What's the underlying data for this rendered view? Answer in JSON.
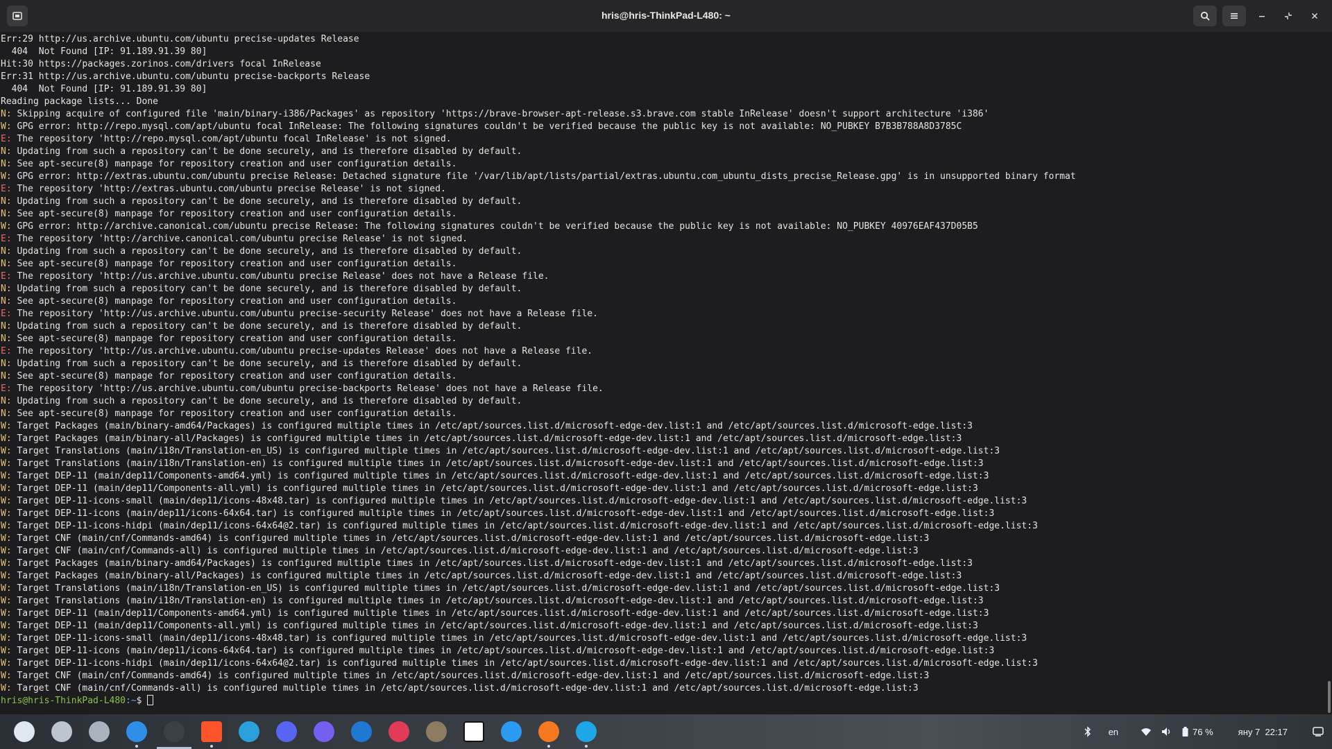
{
  "window": {
    "title": "hris@hris-ThinkPad-L480: ~",
    "icons": {
      "new_tab": "terminal-tab-icon",
      "search": "search-icon",
      "menu": "hamburger-menu-icon",
      "minimize": "minimize-icon",
      "restore": "restore-icon",
      "close": "close-icon"
    }
  },
  "terminal": {
    "lines": [
      {
        "p": "",
        "t": "Err:29 http://us.archive.ubuntu.com/ubuntu precise-updates Release"
      },
      {
        "p": "",
        "t": "  404  Not Found [IP: 91.189.91.39 80]"
      },
      {
        "p": "",
        "t": "Hit:30 https://packages.zorinos.com/drivers focal InRelease"
      },
      {
        "p": "",
        "t": "Err:31 http://us.archive.ubuntu.com/ubuntu precise-backports Release"
      },
      {
        "p": "",
        "t": "  404  Not Found [IP: 91.189.91.39 80]"
      },
      {
        "p": "",
        "t": "Reading package lists... Done"
      },
      {
        "p": "N:",
        "t": " Skipping acquire of configured file 'main/binary-i386/Packages' as repository 'https://brave-browser-apt-release.s3.brave.com stable InRelease' doesn't support architecture 'i386'"
      },
      {
        "p": "W:",
        "t": " GPG error: http://repo.mysql.com/apt/ubuntu focal InRelease: The following signatures couldn't be verified because the public key is not available: NO_PUBKEY B7B3B788A8D3785C"
      },
      {
        "p": "E:",
        "t": " The repository 'http://repo.mysql.com/apt/ubuntu focal InRelease' is not signed."
      },
      {
        "p": "N:",
        "t": " Updating from such a repository can't be done securely, and is therefore disabled by default."
      },
      {
        "p": "N:",
        "t": " See apt-secure(8) manpage for repository creation and user configuration details."
      },
      {
        "p": "W:",
        "t": " GPG error: http://extras.ubuntu.com/ubuntu precise Release: Detached signature file '/var/lib/apt/lists/partial/extras.ubuntu.com_ubuntu_dists_precise_Release.gpg' is in unsupported binary format"
      },
      {
        "p": "E:",
        "t": " The repository 'http://extras.ubuntu.com/ubuntu precise Release' is not signed."
      },
      {
        "p": "N:",
        "t": " Updating from such a repository can't be done securely, and is therefore disabled by default."
      },
      {
        "p": "N:",
        "t": " See apt-secure(8) manpage for repository creation and user configuration details."
      },
      {
        "p": "W:",
        "t": " GPG error: http://archive.canonical.com/ubuntu precise Release: The following signatures couldn't be verified because the public key is not available: NO_PUBKEY 40976EAF437D05B5"
      },
      {
        "p": "E:",
        "t": " The repository 'http://archive.canonical.com/ubuntu precise Release' is not signed."
      },
      {
        "p": "N:",
        "t": " Updating from such a repository can't be done securely, and is therefore disabled by default."
      },
      {
        "p": "N:",
        "t": " See apt-secure(8) manpage for repository creation and user configuration details."
      },
      {
        "p": "E:",
        "t": " The repository 'http://us.archive.ubuntu.com/ubuntu precise Release' does not have a Release file."
      },
      {
        "p": "N:",
        "t": " Updating from such a repository can't be done securely, and is therefore disabled by default."
      },
      {
        "p": "N:",
        "t": " See apt-secure(8) manpage for repository creation and user configuration details."
      },
      {
        "p": "E:",
        "t": " The repository 'http://us.archive.ubuntu.com/ubuntu precise-security Release' does not have a Release file."
      },
      {
        "p": "N:",
        "t": " Updating from such a repository can't be done securely, and is therefore disabled by default."
      },
      {
        "p": "N:",
        "t": " See apt-secure(8) manpage for repository creation and user configuration details."
      },
      {
        "p": "E:",
        "t": " The repository 'http://us.archive.ubuntu.com/ubuntu precise-updates Release' does not have a Release file."
      },
      {
        "p": "N:",
        "t": " Updating from such a repository can't be done securely, and is therefore disabled by default."
      },
      {
        "p": "N:",
        "t": " See apt-secure(8) manpage for repository creation and user configuration details."
      },
      {
        "p": "E:",
        "t": " The repository 'http://us.archive.ubuntu.com/ubuntu precise-backports Release' does not have a Release file."
      },
      {
        "p": "N:",
        "t": " Updating from such a repository can't be done securely, and is therefore disabled by default."
      },
      {
        "p": "N:",
        "t": " See apt-secure(8) manpage for repository creation and user configuration details."
      },
      {
        "p": "W:",
        "t": " Target Packages (main/binary-amd64/Packages) is configured multiple times in /etc/apt/sources.list.d/microsoft-edge-dev.list:1 and /etc/apt/sources.list.d/microsoft-edge.list:3"
      },
      {
        "p": "W:",
        "t": " Target Packages (main/binary-all/Packages) is configured multiple times in /etc/apt/sources.list.d/microsoft-edge-dev.list:1 and /etc/apt/sources.list.d/microsoft-edge.list:3"
      },
      {
        "p": "W:",
        "t": " Target Translations (main/i18n/Translation-en_US) is configured multiple times in /etc/apt/sources.list.d/microsoft-edge-dev.list:1 and /etc/apt/sources.list.d/microsoft-edge.list:3"
      },
      {
        "p": "W:",
        "t": " Target Translations (main/i18n/Translation-en) is configured multiple times in /etc/apt/sources.list.d/microsoft-edge-dev.list:1 and /etc/apt/sources.list.d/microsoft-edge.list:3"
      },
      {
        "p": "W:",
        "t": " Target DEP-11 (main/dep11/Components-amd64.yml) is configured multiple times in /etc/apt/sources.list.d/microsoft-edge-dev.list:1 and /etc/apt/sources.list.d/microsoft-edge.list:3"
      },
      {
        "p": "W:",
        "t": " Target DEP-11 (main/dep11/Components-all.yml) is configured multiple times in /etc/apt/sources.list.d/microsoft-edge-dev.list:1 and /etc/apt/sources.list.d/microsoft-edge.list:3"
      },
      {
        "p": "W:",
        "t": " Target DEP-11-icons-small (main/dep11/icons-48x48.tar) is configured multiple times in /etc/apt/sources.list.d/microsoft-edge-dev.list:1 and /etc/apt/sources.list.d/microsoft-edge.list:3"
      },
      {
        "p": "W:",
        "t": " Target DEP-11-icons (main/dep11/icons-64x64.tar) is configured multiple times in /etc/apt/sources.list.d/microsoft-edge-dev.list:1 and /etc/apt/sources.list.d/microsoft-edge.list:3"
      },
      {
        "p": "W:",
        "t": " Target DEP-11-icons-hidpi (main/dep11/icons-64x64@2.tar) is configured multiple times in /etc/apt/sources.list.d/microsoft-edge-dev.list:1 and /etc/apt/sources.list.d/microsoft-edge.list:3"
      },
      {
        "p": "W:",
        "t": " Target CNF (main/cnf/Commands-amd64) is configured multiple times in /etc/apt/sources.list.d/microsoft-edge-dev.list:1 and /etc/apt/sources.list.d/microsoft-edge.list:3"
      },
      {
        "p": "W:",
        "t": " Target CNF (main/cnf/Commands-all) is configured multiple times in /etc/apt/sources.list.d/microsoft-edge-dev.list:1 and /etc/apt/sources.list.d/microsoft-edge.list:3"
      },
      {
        "p": "W:",
        "t": " Target Packages (main/binary-amd64/Packages) is configured multiple times in /etc/apt/sources.list.d/microsoft-edge-dev.list:1 and /etc/apt/sources.list.d/microsoft-edge.list:3"
      },
      {
        "p": "W:",
        "t": " Target Packages (main/binary-all/Packages) is configured multiple times in /etc/apt/sources.list.d/microsoft-edge-dev.list:1 and /etc/apt/sources.list.d/microsoft-edge.list:3"
      },
      {
        "p": "W:",
        "t": " Target Translations (main/i18n/Translation-en_US) is configured multiple times in /etc/apt/sources.list.d/microsoft-edge-dev.list:1 and /etc/apt/sources.list.d/microsoft-edge.list:3"
      },
      {
        "p": "W:",
        "t": " Target Translations (main/i18n/Translation-en) is configured multiple times in /etc/apt/sources.list.d/microsoft-edge-dev.list:1 and /etc/apt/sources.list.d/microsoft-edge.list:3"
      },
      {
        "p": "W:",
        "t": " Target DEP-11 (main/dep11/Components-amd64.yml) is configured multiple times in /etc/apt/sources.list.d/microsoft-edge-dev.list:1 and /etc/apt/sources.list.d/microsoft-edge.list:3"
      },
      {
        "p": "W:",
        "t": " Target DEP-11 (main/dep11/Components-all.yml) is configured multiple times in /etc/apt/sources.list.d/microsoft-edge-dev.list:1 and /etc/apt/sources.list.d/microsoft-edge.list:3"
      },
      {
        "p": "W:",
        "t": " Target DEP-11-icons-small (main/dep11/icons-48x48.tar) is configured multiple times in /etc/apt/sources.list.d/microsoft-edge-dev.list:1 and /etc/apt/sources.list.d/microsoft-edge.list:3"
      },
      {
        "p": "W:",
        "t": " Target DEP-11-icons (main/dep11/icons-64x64.tar) is configured multiple times in /etc/apt/sources.list.d/microsoft-edge-dev.list:1 and /etc/apt/sources.list.d/microsoft-edge.list:3"
      },
      {
        "p": "W:",
        "t": " Target DEP-11-icons-hidpi (main/dep11/icons-64x64@2.tar) is configured multiple times in /etc/apt/sources.list.d/microsoft-edge-dev.list:1 and /etc/apt/sources.list.d/microsoft-edge.list:3"
      },
      {
        "p": "W:",
        "t": " Target CNF (main/cnf/Commands-amd64) is configured multiple times in /etc/apt/sources.list.d/microsoft-edge-dev.list:1 and /etc/apt/sources.list.d/microsoft-edge.list:3"
      },
      {
        "p": "W:",
        "t": " Target CNF (main/cnf/Commands-all) is configured multiple times in /etc/apt/sources.list.d/microsoft-edge-dev.list:1 and /etc/apt/sources.list.d/microsoft-edge.list:3"
      }
    ],
    "prompt": {
      "user_host": "hris@hris-ThinkPad-L480",
      "path": ":~",
      "symbol": "$ "
    }
  },
  "taskbar": {
    "apps": [
      {
        "name": "zorin-menu-icon",
        "color": "#dfe7ef",
        "running": false,
        "active": false
      },
      {
        "name": "files-icon",
        "color": "#bcc6d0",
        "running": false,
        "active": false
      },
      {
        "name": "file-manager-icon",
        "color": "#aab3bd",
        "running": false,
        "active": false
      },
      {
        "name": "software-store-icon",
        "color": "#2f8fe8",
        "running": true,
        "active": false
      },
      {
        "name": "terminal-icon",
        "color": "#3b4047",
        "running": true,
        "active": true
      },
      {
        "name": "brave-icon",
        "color": "#fb542b",
        "running": true,
        "active": false
      },
      {
        "name": "telegram-icon",
        "color": "#2aa1da",
        "running": false,
        "active": false
      },
      {
        "name": "discord-icon",
        "color": "#5865f2",
        "running": false,
        "active": false
      },
      {
        "name": "viber-icon",
        "color": "#7360f2",
        "running": false,
        "active": false
      },
      {
        "name": "trello-icon",
        "color": "#1f78d1",
        "running": false,
        "active": false
      },
      {
        "name": "photos-icon",
        "color": "#e23b5a",
        "running": false,
        "active": false
      },
      {
        "name": "gimp-icon",
        "color": "#8d7b62",
        "running": false,
        "active": false
      },
      {
        "name": "notion-icon",
        "color": "#ffffff",
        "running": false,
        "active": false
      },
      {
        "name": "vscode-icon",
        "color": "#2a9bf2",
        "running": false,
        "active": false
      },
      {
        "name": "sync-icon",
        "color": "#f47920",
        "running": true,
        "active": false
      },
      {
        "name": "download-icon",
        "color": "#1ea7e8",
        "running": true,
        "active": false
      }
    ],
    "tray": {
      "bluetooth_icon": "bluetooth-icon",
      "language": "en",
      "wifi_icon": "wifi-icon",
      "volume_icon": "volume-icon",
      "battery_icon": "battery-icon",
      "battery": "76 %",
      "clock": "яну 7  22:17",
      "notifications_icon": "notifications-icon"
    }
  }
}
